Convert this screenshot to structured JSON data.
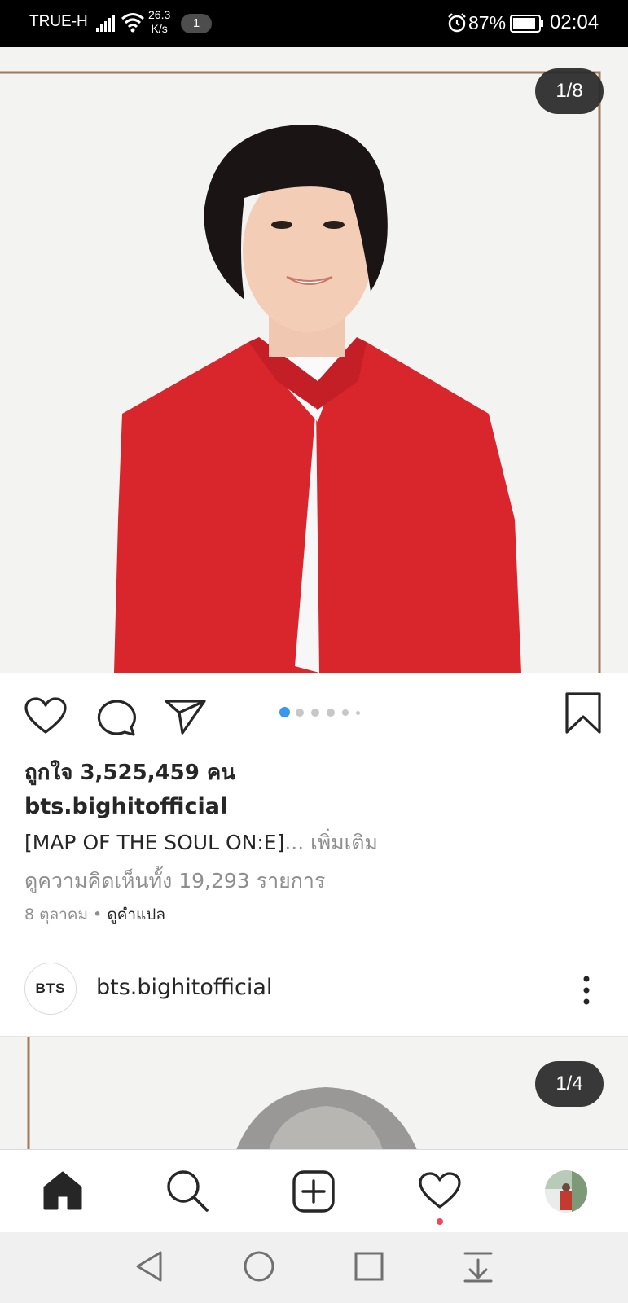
{
  "status_bar": {
    "carrier": "TRUE-H",
    "net_speed_value": "26.3",
    "net_speed_unit": "K/s",
    "notification_count": "1",
    "battery": "87%",
    "time": "02:04"
  },
  "post1": {
    "photo_counter": "1/8",
    "carousel_dots": 6,
    "carousel_active_index": 0,
    "likes_text": "ถูกใจ 3,525,459 คน",
    "username": "bts.bighitofficial",
    "caption": "[MAP OF THE SOUL ON:E]",
    "caption_ellipsis": "... ",
    "caption_more": "เพิ่มเติม",
    "comments_link": "ดูความคิดเห็นทั้ง 19,293 รายการ",
    "date": "8 ตุลาคม",
    "separator": " • ",
    "translate_link": "ดูคำแปล"
  },
  "post2": {
    "avatar_text": "BTS",
    "username": "bts.bighitofficial",
    "photo_counter": "1/4"
  },
  "colors": {
    "accent_blue": "#3897f0",
    "notification_dot": "#ed4956",
    "jacket_red": "#d9252c",
    "frame_brown": "#a07a5a"
  },
  "icons": {
    "like": "heart-outline-icon",
    "comment": "comment-bubble-icon",
    "share": "paper-plane-icon",
    "save": "bookmark-icon",
    "tab_home": "home-filled-icon",
    "tab_search": "search-icon",
    "tab_new_post": "plus-square-icon",
    "tab_activity": "heart-outline-icon",
    "tab_profile": "profile-avatar",
    "nav_back": "triangle-back-icon",
    "nav_home": "circle-home-icon",
    "nav_recents": "square-recents-icon",
    "nav_notifications": "pull-down-icon"
  }
}
